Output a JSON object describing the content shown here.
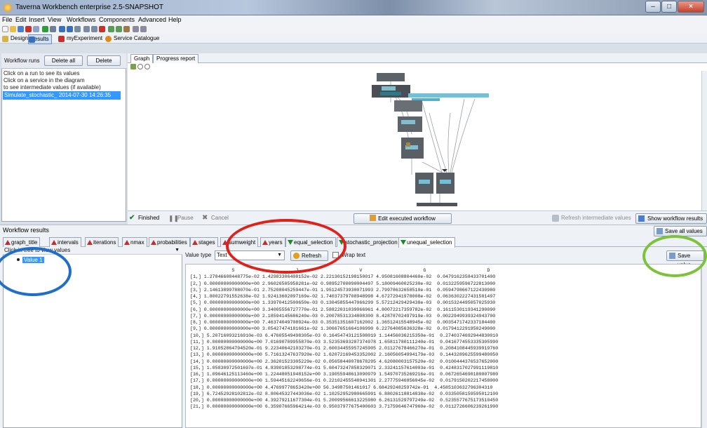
{
  "window": {
    "title": "Taverna Workbench enterprise 2.5-SNAPSHOT"
  },
  "menu": [
    "File",
    "Edit",
    "Insert",
    "View",
    "Workflows",
    "Components",
    "Advanced",
    "Help"
  ],
  "perspectives": [
    {
      "label": "Design",
      "icon": "design-icon"
    },
    {
      "label": "Results",
      "icon": "results-icon",
      "selected": true
    },
    {
      "label": "myExperiment",
      "icon": "myexperiment-icon"
    },
    {
      "label": "Service Catalogue",
      "icon": "service-catalogue-icon"
    }
  ],
  "left": {
    "runs_label": "Workflow runs",
    "delete_all": "Delete all",
    "delete": "Delete",
    "hints": [
      "Click on a run to see its values",
      "Click on a service in the diagram",
      "to see intermediate values (if available)"
    ],
    "runs": [
      "Simulate_stochastic_ 2014-07-30 14:26:35"
    ]
  },
  "graph": {
    "tabs": [
      "Graph",
      "Progress report"
    ],
    "status": [
      {
        "label": "Finished",
        "icon": "check-icon"
      },
      {
        "label": "Pause",
        "icon": "pause-icon"
      },
      {
        "label": "Cancel",
        "icon": "cancel-icon"
      }
    ],
    "edit": "Edit executed workflow",
    "refresh_intermediate": "Refresh intermediate values",
    "show_results": "Show workflow results"
  },
  "results": {
    "title": "Workflow results",
    "save_all": "Save all values",
    "port_tabs": [
      {
        "label": "graph_title",
        "dir": "up"
      },
      {
        "label": "intervals",
        "dir": "up"
      },
      {
        "label": "iterations",
        "dir": "up"
      },
      {
        "label": "nmax",
        "dir": "up"
      },
      {
        "label": "probabilities",
        "dir": "up"
      },
      {
        "label": "stages",
        "dir": "up"
      },
      {
        "label": "sumweight",
        "dir": "up"
      },
      {
        "label": "years",
        "dir": "up"
      },
      {
        "label": "equal_selection",
        "dir": "down"
      },
      {
        "label": "stochastic_projection",
        "dir": "down"
      },
      {
        "label": "unequal_selection",
        "dir": "down",
        "active": true
      }
    ],
    "tree_hint": "Click in tree to view values",
    "tree_value": "Value 1",
    "value_type_label": "Value type",
    "value_type": "Text",
    "refresh": "Refresh",
    "wrap": "Wrap text",
    "save_value": "Save value",
    "columns_header": "               S                      J                      V                      G                      D",
    "rows": [
      "[1,] 1.27846608448775e-02 1.42983306408152e-02 2.22130152198150017 4.95081608804460e-02  0.0479162358433701400",
      "[2,] 0.00000000000000e+00 2.96026505958281e-02 0.98952700090004497 5.18009460025230e-02  0.0132259596722813000",
      "[3,] 2.14613899788070e-01 2.75208045259447e-01 1.95124573930071993 2.79978632658510e-01  0.0594798667122430980",
      "[4,] 1.80022791552638e-02 1.92413602097169e-02 1.74037379708948998 4.67272941978008e-02  0.0636302227431501497",
      "[5,] 0.00000000000000e+00 1.33970412500650e-03 0.13045855447066299 5.57212429429438e-03  0.0015324495057025930",
      "[6,] 0.00000000000000e+00 3.34005556727770e-01 2.58822031039066961 4.80072217359782e-02  0.1611530119341290090",
      "[7,] 0.00000000000000e+00 2.18594145686240e-03 0.20078531334808300 8.42878702497919e-03  0.0022949939324943700",
      "[8,] 0.00000000000000e+00 7.46374049708924e-03 0.35351351607162002 1.36512415548945e-02  0.0035471742337184400",
      "[9,] 0.00000000000000e+00 3.05427474181661e-02 1.30667651664106990 6.22764085636328e-02  0.0179412291950249000",
      "[10,] 5.20716093216910e-03 6.47605549498305e-03 0.16454743121508019 1.14456036215350e-01  0.2740374692944830010",
      "[11,] 0.00000000000000e+00 7.01690709955870e-03 3.52353693287374978 1.65811780111240e-01  0.0416774553335305990",
      "[12,] 1.91052864794520e-01 9.22340642103270e-01 2.60034455957245905 2.01127678466270e-01  0.2084108445939919760",
      "[13,] 0.00000000000000e+00 5.71613247637920e-02 1.62072169453352002 2.16056054994179e-03  0.1443289625599480050",
      "[14,] 0.00000000000000e+00 2.36201523305229e-02 0.05658440078678295 4.62080003157520e-02  0.0100444376537652000",
      "[15,] 1.05830972501697e-01 4.83901853208774e-01 5.60473247858329071 2.33241157614003e-01  0.4248317027991119810",
      "[16,] 1.09646125113460e+00 1.22448051948152e+00 3.19055948613090979 1.54970735269216e-01  0.0672654690180007980",
      "[17,] 0.00000000000000e+00 1.59445162249656e-01 0.22102455548941301 2.27775946856045e-02  0.0179150202217458000",
      "[18,] 0.00000000000000e+00 4.47699778653420e+00 56.34987501461017 6.68429248259742e-01  4.4585103632796304310",
      "[19,] 6.72452928102812e-02 8.80645327443036e-02 1.10252952980665991 6.88026118814838e-02  0.0335058159595012100",
      "[20,] 0.00000000000000e+00 4.39279211677304e-01 5.20099566613225980 6.26131529797249e-02  0.5235577675173510450",
      "[21,] 0.00000000000000e+00 6.35907665964214e-03 0.95037977675400603 3.71759646747960e-02  0.0112726606239261990"
    ]
  }
}
